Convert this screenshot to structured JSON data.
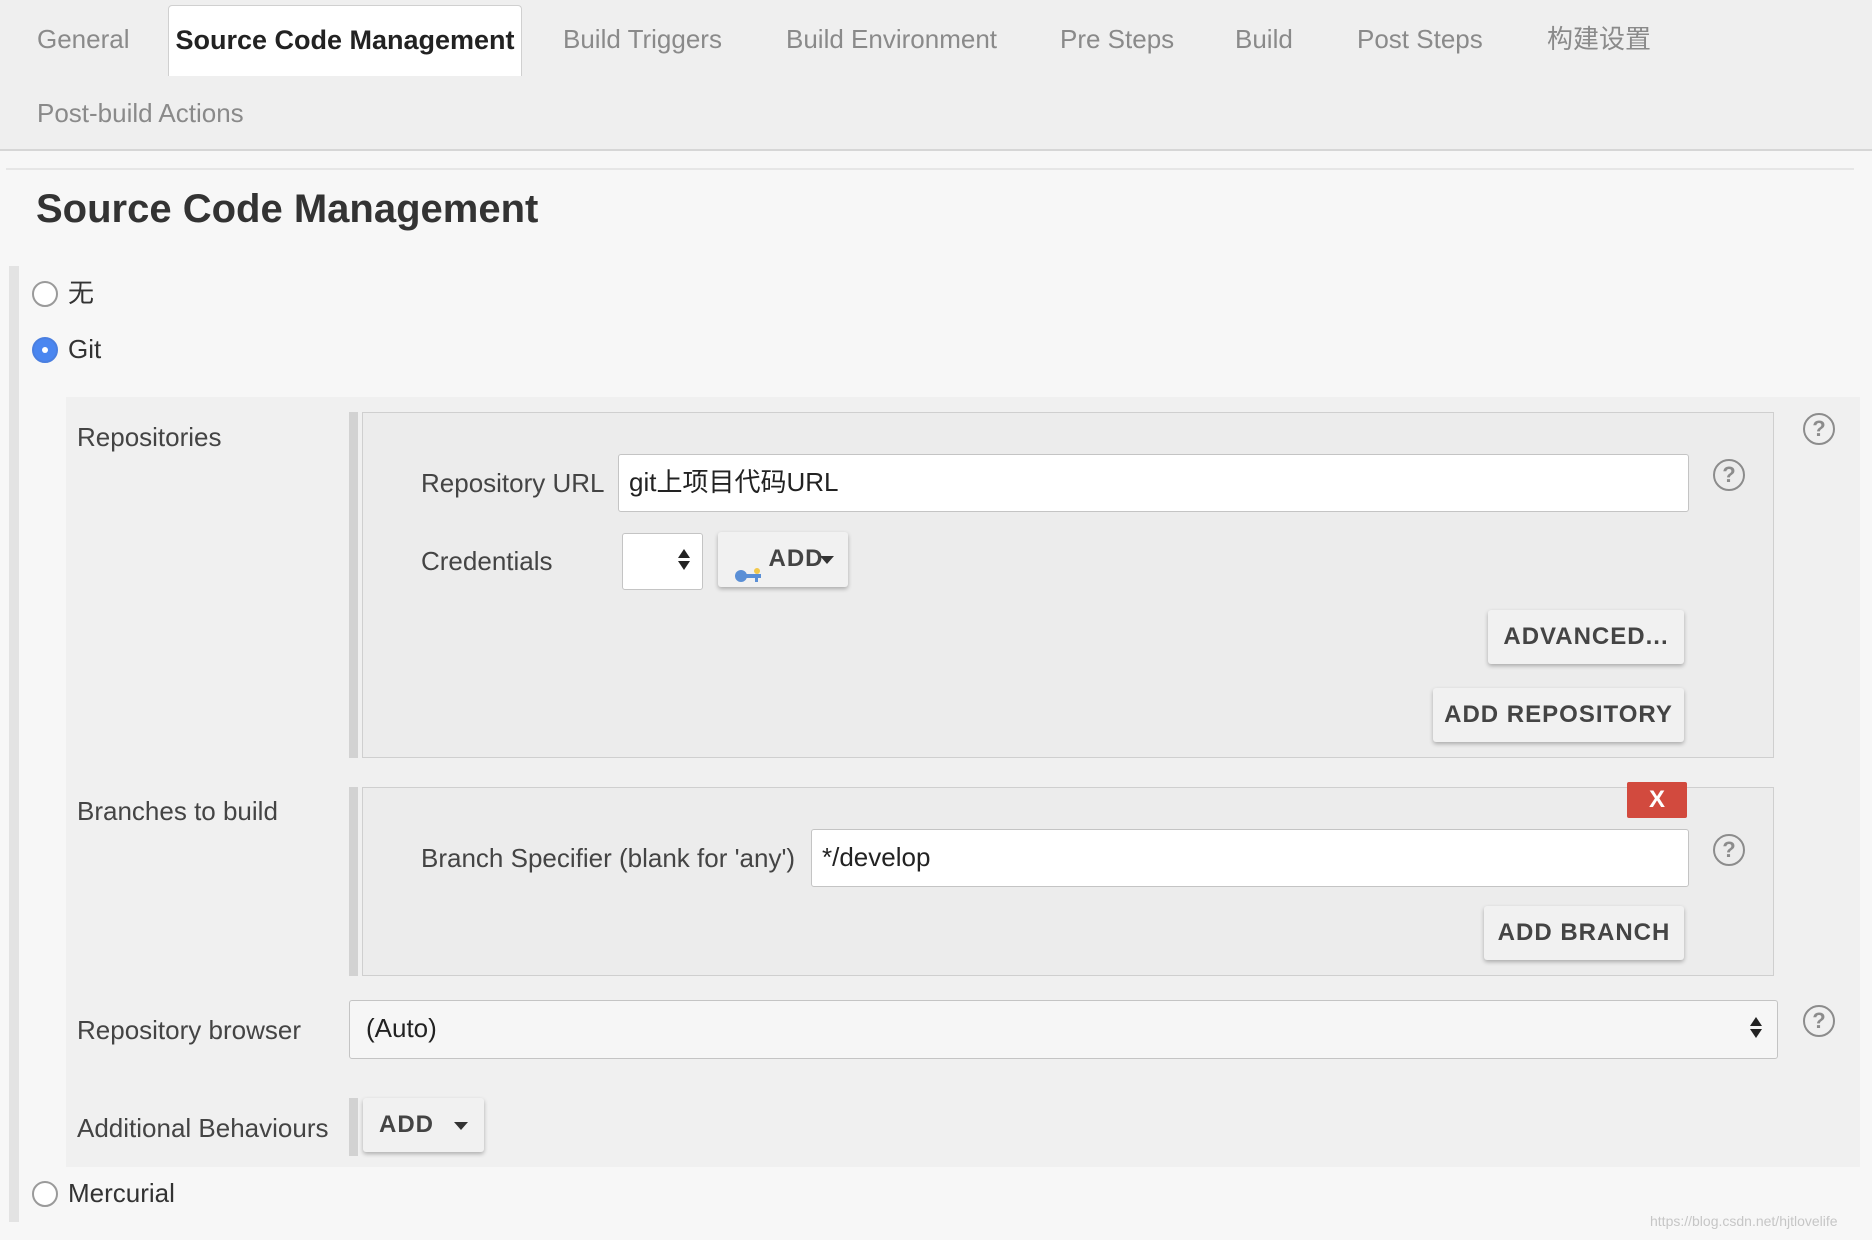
{
  "tabs": {
    "general": "General",
    "scm": "Source Code Management",
    "build_triggers": "Build Triggers",
    "build_environment": "Build Environment",
    "pre_steps": "Pre Steps",
    "build": "Build",
    "post_steps": "Post Steps",
    "build_settings": "构建设置",
    "post_build_actions": "Post-build Actions"
  },
  "section": {
    "title": "Source Code Management"
  },
  "scm_options": {
    "none": {
      "label": "无",
      "selected": false
    },
    "git": {
      "label": "Git",
      "selected": true
    },
    "mercurial": {
      "label": "Mercurial",
      "selected": false
    }
  },
  "git": {
    "repositories_label": "Repositories",
    "repository_url_label": "Repository URL",
    "repository_url_value": "git上项目代码URL",
    "credentials_label": "Credentials",
    "credentials_value": "",
    "add_credentials_button": "ADD",
    "advanced_button": "ADVANCED...",
    "add_repository_button": "ADD REPOSITORY",
    "branches_label": "Branches to build",
    "delete_branch_button": "X",
    "branch_specifier_label": "Branch Specifier (blank for 'any')",
    "branch_specifier_value": "*/develop",
    "add_branch_button": "ADD BRANCH",
    "repository_browser_label": "Repository browser",
    "repository_browser_value": "(Auto)",
    "additional_behaviours_label": "Additional Behaviours",
    "add_behaviour_button": "ADD"
  },
  "help_icon_text": "?",
  "watermark": "https://blog.csdn.net/hjtlovelife",
  "colors": {
    "accent_radio": "#4a86f0",
    "delete_button": "#d24a3e",
    "panel_bg": "#f0f0f0",
    "page_bg": "#f7f7f7"
  }
}
